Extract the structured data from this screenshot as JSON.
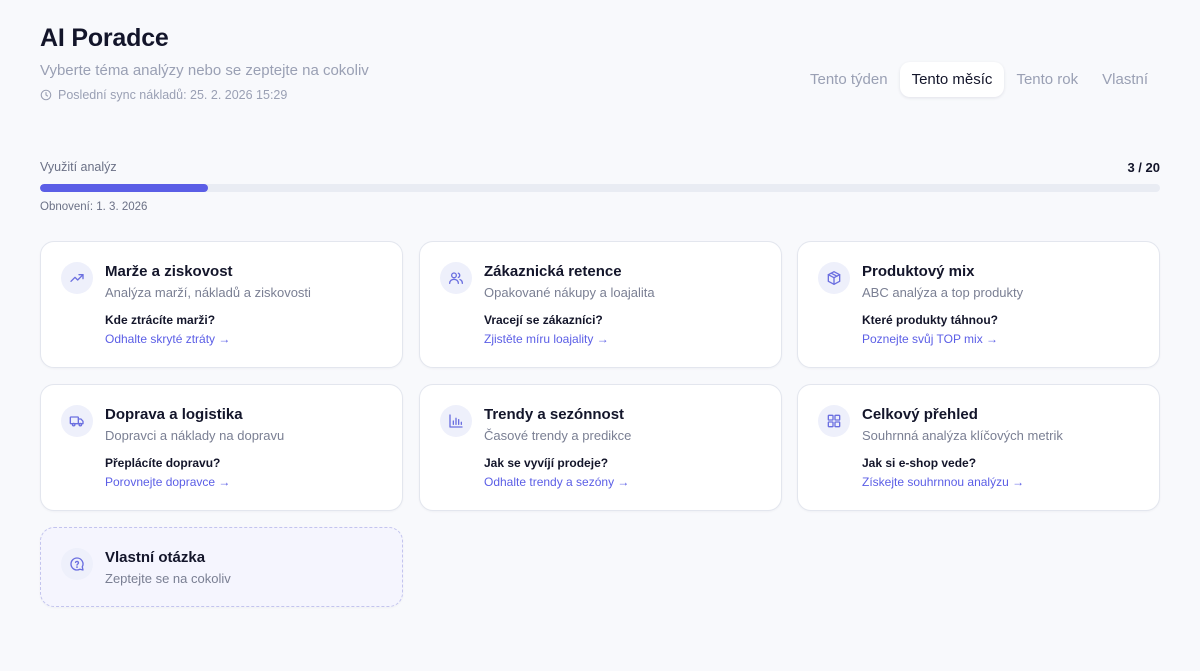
{
  "header": {
    "title": "AI Poradce",
    "subtitle": "Vyberte téma analýzy nebo se zeptejte na cokoliv",
    "sync_text": "Poslední sync nákladů: 25. 2. 2026 15:29"
  },
  "period_tabs": [
    {
      "label": "Tento týden",
      "active": false
    },
    {
      "label": "Tento měsíc",
      "active": true
    },
    {
      "label": "Tento rok",
      "active": false
    },
    {
      "label": "Vlastní",
      "active": false
    }
  ],
  "usage": {
    "label": "Využití analýz",
    "count_text": "3 / 20",
    "used": 3,
    "limit": 20,
    "renewal_text": "Obnovení: 1. 3. 2026"
  },
  "colors": {
    "accent": "#5b5ee6",
    "icon_bg": "#eef0fb",
    "icon_stroke": "#6b6fe0"
  },
  "cards": [
    {
      "icon": "trending-up-icon",
      "title": "Marže a ziskovost",
      "subtitle": "Analýza marží, nákladů a ziskovosti",
      "question": "Kde ztrácíte marži?",
      "link": "Odhalte skryté ztráty →"
    },
    {
      "icon": "users-icon",
      "title": "Zákaznická retence",
      "subtitle": "Opakované nákupy a loajalita",
      "question": "Vracejí se zákazníci?",
      "link": "Zjistěte míru loajality →"
    },
    {
      "icon": "package-icon",
      "title": "Produktový mix",
      "subtitle": "ABC analýza a top produkty",
      "question": "Které produkty táhnou?",
      "link": "Poznejte svůj TOP mix →"
    },
    {
      "icon": "truck-icon",
      "title": "Doprava a logistika",
      "subtitle": "Dopravci a náklady na dopravu",
      "question": "Přeplácíte dopravu?",
      "link": "Porovnejte dopravce →"
    },
    {
      "icon": "bar-chart-icon",
      "title": "Trendy a sezónnost",
      "subtitle": "Časové trendy a predikce",
      "question": "Jak se vyvíjí prodeje?",
      "link": "Odhalte trendy a sezóny →"
    },
    {
      "icon": "grid-icon",
      "title": "Celkový přehled",
      "subtitle": "Souhrnná analýza klíčových metrik",
      "question": "Jak si e-shop vede?",
      "link": "Získejte souhrnnou analýzu →"
    }
  ],
  "custom_question": {
    "icon": "help-circle-icon",
    "title": "Vlastní otázka",
    "subtitle": "Zeptejte se na cokoliv"
  }
}
